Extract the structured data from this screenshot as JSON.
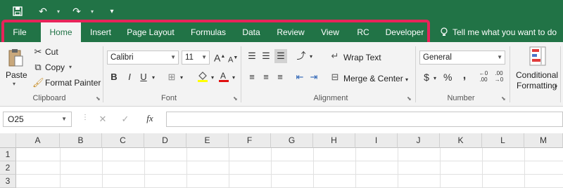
{
  "quick_access": {
    "save_icon": "save-icon",
    "undo_icon": "undo-icon",
    "redo_icon": "redo-icon",
    "customize_icon": "customize-icon"
  },
  "tabs": [
    {
      "label": "File"
    },
    {
      "label": "Home"
    },
    {
      "label": "Insert"
    },
    {
      "label": "Page Layout"
    },
    {
      "label": "Formulas"
    },
    {
      "label": "Data"
    },
    {
      "label": "Review"
    },
    {
      "label": "View"
    },
    {
      "label": "RC"
    },
    {
      "label": "Developer"
    }
  ],
  "active_tab": "Home",
  "tell_me": "Tell me what you want to do",
  "clipboard": {
    "paste": "Paste",
    "cut": "Cut",
    "copy": "Copy",
    "format_painter": "Format Painter",
    "label": "Clipboard"
  },
  "font": {
    "name": "Calibri",
    "size": "11",
    "label": "Font",
    "bold": "B",
    "italic": "I",
    "underline": "U"
  },
  "alignment": {
    "wrap_text": "Wrap Text",
    "merge_center": "Merge & Center",
    "label": "Alignment"
  },
  "number": {
    "format": "General",
    "currency": "$",
    "percent": "%",
    "comma": ",",
    "label": "Number"
  },
  "styles": {
    "conditional": "Conditional",
    "formatting": "Formatting"
  },
  "formula_bar": {
    "name_box": "O25",
    "fx": "fx",
    "value": ""
  },
  "columns": [
    "A",
    "B",
    "C",
    "D",
    "E",
    "F",
    "G",
    "H",
    "I",
    "J",
    "K",
    "L",
    "M"
  ],
  "rows": [
    "1",
    "2",
    "3"
  ],
  "colors": {
    "excel_green": "#217346",
    "highlight": "#e8245a",
    "ribbon": "#f3f3f3"
  }
}
